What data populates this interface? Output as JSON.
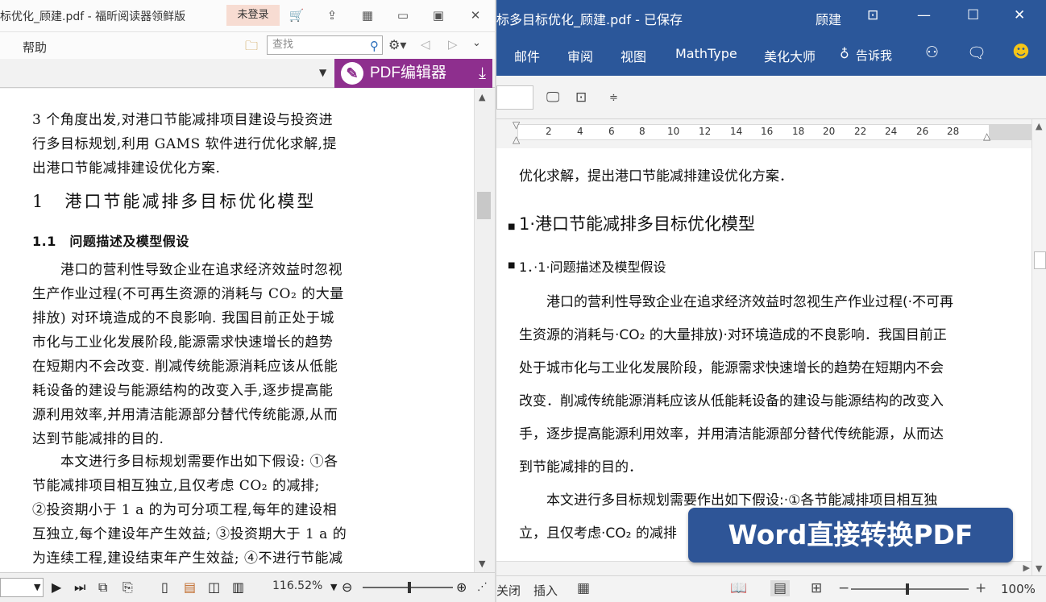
{
  "pdf_reader": {
    "title": "标优化_顾建.pdf - 福昕阅读器领鲜版",
    "login_label": "未登录",
    "help_menu": "帮助",
    "search_placeholder": "查找",
    "pdf_editor_label": "PDF编辑器",
    "zoom": "116.52%",
    "lines": [
      "3 个角度出发,对港口节能减排项目建设与投资进",
      "行多目标规划,利用 GAMS 软件进行优化求解,提",
      "出港口节能减排建设优化方案."
    ],
    "heading1": "1　港口节能减排多目标优化模型",
    "heading2": "1.1　问题描述及模型假设",
    "para1": [
      "　　港口的营利性导致企业在追求经济效益时忽视",
      "生产作业过程(不可再生资源的消耗与 CO₂ 的大量",
      "排放) 对环境造成的不良影响. 我国目前正处于城",
      "市化与工业化发展阶段,能源需求快速增长的趋势",
      "在短期内不会改变. 削减传统能源消耗应该从低能",
      "耗设备的建设与能源结构的改变入手,逐步提高能",
      "源利用效率,并用清洁能源部分替代传统能源,从而",
      "达到节能减排的目的."
    ],
    "para2": [
      "　　本文进行多目标规划需要作出如下假设: ①各",
      "节能减排项目相互独立,且仅考虑 CO₂ 的减排;",
      "②投资期小于 1 a 的为可分项工程,每年的建设相",
      "互独立,每个建设年产生效益; ③投资期大于 1 a 的",
      "为连续工程,建设结束年产生效益; ④不进行节能减"
    ]
  },
  "word": {
    "title": "标多目标优化_顾建.pdf - 已保存",
    "user": "顾建",
    "tabs": [
      "邮件",
      "审阅",
      "视图",
      "MathType",
      "美化大师",
      "告诉我"
    ],
    "ruler_numbers": [
      "2",
      "4",
      "6",
      "8",
      "10",
      "12",
      "14",
      "16",
      "18",
      "20",
      "22",
      "24",
      "26",
      "28"
    ],
    "lines": [
      "优化求解，提出港口节能减排建设优化方案．"
    ],
    "heading1": "1·港口节能减排多目标优化模型",
    "heading2": "1．·1·问题描述及模型假设",
    "para1": [
      "　　港口的营利性导致企业在追求经济效益时忽视生产作业过程(·不可再",
      "生资源的消耗与·CO₂ 的大量排放)·对环境造成的不良影响．我国目前正",
      "处于城市化与工业化发展阶段，能源需求快速增长的趋势在短期内不会",
      "改变．削减传统能源消耗应该从低能耗设备的建设与能源结构的改变入",
      "手，逐步提高能源利用效率，并用清洁能源部分替代传统能源，从而达",
      "到节能减排的目的．"
    ],
    "para2": [
      "　　本文进行多目标规划需要作出如下假设:·①各节能减排项目相互独",
      "立，且仅考虑·CO₂ 的减排"
    ],
    "status_close": "关闭",
    "status_insert": "插入",
    "zoom": "100%",
    "badge": "Word直接转换PDF"
  }
}
